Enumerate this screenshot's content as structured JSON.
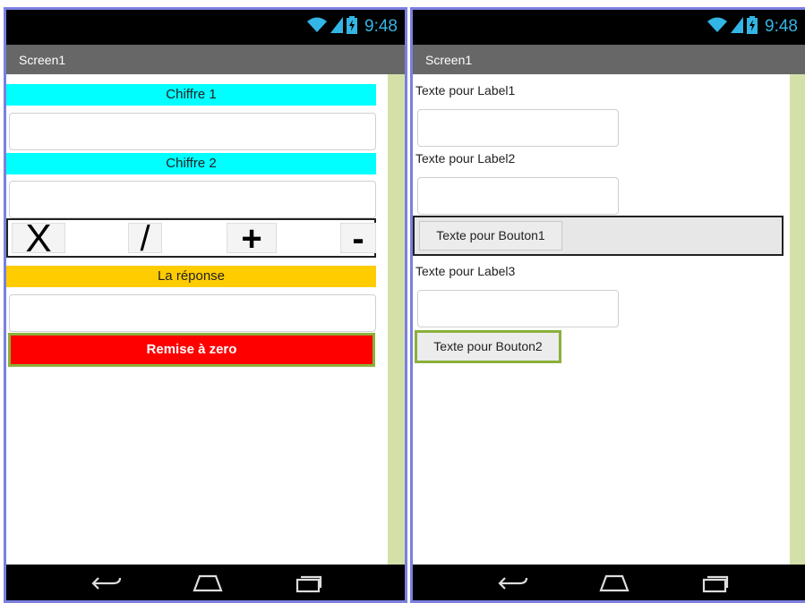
{
  "status_bar": {
    "time": "9:48",
    "icons": [
      "wifi-icon",
      "signal-icon",
      "battery-charging-icon"
    ],
    "time_color": "#33b5e5"
  },
  "nav_bar": {
    "icons": [
      "back-icon",
      "home-icon",
      "recents-icon"
    ]
  },
  "left_screen": {
    "title": "Screen1",
    "label1": "Chiffre 1",
    "input1_value": "",
    "label2": "Chiffre 2",
    "input2_value": "",
    "operators": [
      "X",
      "/",
      "+",
      "-"
    ],
    "answer_label": "La réponse",
    "answer_value": "",
    "reset_button": "Remise à zero",
    "colors": {
      "label_bg": "#00ffff",
      "answer_bg": "#ffcc00",
      "reset_bg": "#ff0000",
      "scroll_strip": "#d3e1a9"
    }
  },
  "right_screen": {
    "title": "Screen1",
    "label1": "Texte pour Label1",
    "input1_value": "",
    "label2": "Texte pour Label2",
    "input2_value": "",
    "button1": "Texte pour Bouton1",
    "label3": "Texte pour Label3",
    "input3_value": "",
    "button2": "Texte pour Bouton2"
  }
}
